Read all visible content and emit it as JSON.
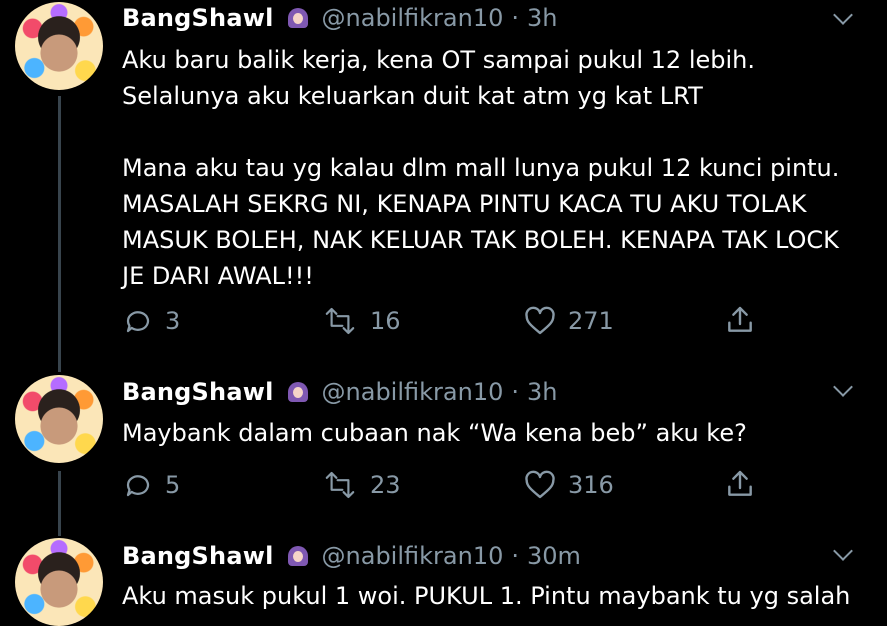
{
  "tweets": [
    {
      "name": "BangShawl",
      "handle": "@nabilfikran10",
      "separator": "·",
      "time": "3h",
      "text": "Aku baru balik kerja, kena OT sampai pukul 12 lebih.\nSelalunya aku keluarkan duit kat atm yg kat LRT\n\nMana aku tau yg kalau dlm mall lunya pukul 12 kunci pintu.\nMASALAH SEKRG NI, KENAPA PINTU KACA TU AKU TOLAK\nMASUK BOLEH, NAK KELUAR TAK BOLEH. KENAPA TAK LOCK\nJE DARI AWAL!!!",
      "replies": "3",
      "retweets": "16",
      "likes": "271"
    },
    {
      "name": "BangShawl",
      "handle": "@nabilfikran10",
      "separator": "·",
      "time": "3h",
      "text": "Maybank dalam cubaan nak “Wa kena beb” aku ke?",
      "replies": "5",
      "retweets": "23",
      "likes": "316"
    },
    {
      "name": "BangShawl",
      "handle": "@nabilfikran10",
      "separator": "·",
      "time": "30m",
      "text": "Aku masuk pukul 1 woi. PUKUL 1. Pintu maybank tu yg salah"
    }
  ],
  "icons": {
    "badge": "woman-with-headscarf-emoji",
    "reply": "reply-icon",
    "retweet": "retweet-icon",
    "like": "heart-icon",
    "share": "share-icon",
    "menu": "chevron-down-icon"
  },
  "colors": {
    "background": "#000000",
    "text": "#ffffff",
    "muted": "#8899a6",
    "thread_line": "#38444d"
  }
}
